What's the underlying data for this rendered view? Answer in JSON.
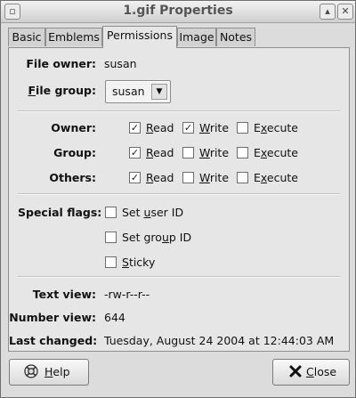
{
  "window": {
    "title": "1.gif Properties",
    "menu_glyph": "▫",
    "minimize_glyph": "▴",
    "close_glyph": "✕"
  },
  "tabs": [
    {
      "label": "Basic"
    },
    {
      "label": "Emblems"
    },
    {
      "label": "Permissions",
      "active": true
    },
    {
      "label": "Image"
    },
    {
      "label": "Notes"
    }
  ],
  "ownership": {
    "owner_label": "File owner:",
    "owner_value": "susan",
    "group_label_mnemonic": "F",
    "group_label_rest": "ile group:",
    "group_value": "susan",
    "arrow": "▼"
  },
  "permissions": {
    "check_glyph": "✓",
    "read_u": "R",
    "read_rest": "ead",
    "write_u": "W",
    "write_rest": "rite",
    "execute_pre": "E",
    "execute_u": "x",
    "execute_rest": "ecute",
    "rows": [
      {
        "label": "Owner:",
        "read": true,
        "write": true,
        "execute": false
      },
      {
        "label": "Group:",
        "read": true,
        "write": false,
        "execute": false
      },
      {
        "label": "Others:",
        "read": true,
        "write": false,
        "execute": false
      }
    ]
  },
  "special_flags": {
    "label": "Special flags:",
    "set_user_pre": "Set ",
    "set_user_u": "u",
    "set_user_rest": "ser ID",
    "set_group_pre": "Set gro",
    "set_group_u": "u",
    "set_group_rest": "p ID",
    "sticky_u": "S",
    "sticky_rest": "ticky",
    "set_user": false,
    "set_group": false,
    "sticky": false
  },
  "info": {
    "text_view_label": "Text view:",
    "text_view_value": "-rw-r--r--",
    "number_view_label": "Number view:",
    "number_view_value": "644",
    "last_changed_label": "Last changed:",
    "last_changed_value": "Tuesday, August 24 2004 at 12:44:03 AM"
  },
  "buttons": {
    "help_u": "H",
    "help_rest": "elp",
    "close_u": "C",
    "close_rest": "lose"
  }
}
